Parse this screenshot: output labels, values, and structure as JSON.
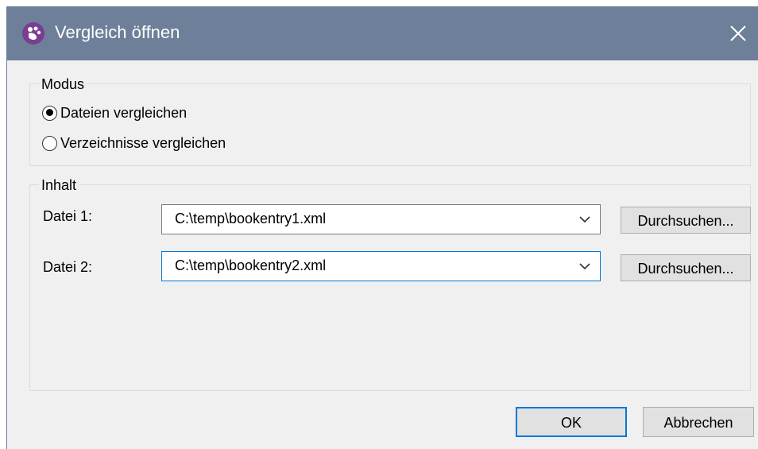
{
  "window": {
    "title": "Vergleich öffnen",
    "titlebar_color": "#6d7f99",
    "icon": "app-logo-icon",
    "close_icon": "close-icon"
  },
  "mode_group": {
    "legend": "Modus",
    "options": [
      {
        "label": "Dateien vergleichen",
        "checked": true
      },
      {
        "label": "Verzeichnisse vergleichen",
        "checked": false
      }
    ]
  },
  "content_group": {
    "legend": "Inhalt",
    "file1": {
      "label": "Datei 1:",
      "value": "C:\\temp\\bookentry1.xml",
      "browse_label": "Durchsuchen..."
    },
    "file2": {
      "label": "Datei 2:",
      "value": "C:\\temp\\bookentry2.xml",
      "browse_label": "Durchsuchen..."
    }
  },
  "buttons": {
    "ok_label": "OK",
    "cancel_label": "Abbrechen"
  },
  "colors": {
    "accent": "#0078d7",
    "dialog_bg": "#f0f0f0",
    "app_icon": "#7a3d92"
  }
}
